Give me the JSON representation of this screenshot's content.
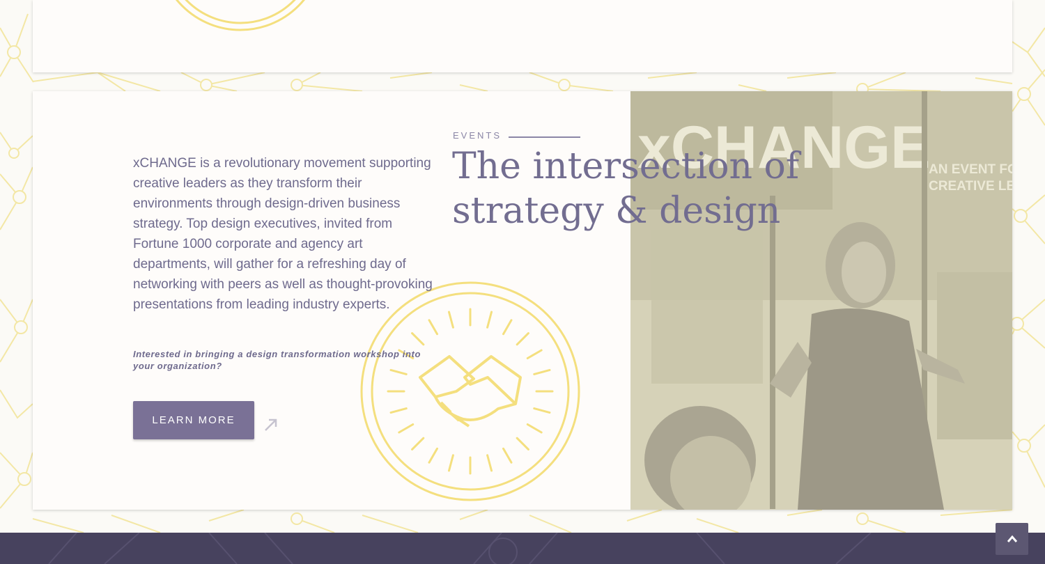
{
  "events": {
    "label": "EVENTS",
    "headline": "The intersection of strategy & design"
  },
  "intro": {
    "body": "xCHANGE is a revolutionary movement supporting creative leaders as they transform their environments through design-driven business strategy. Top design executives, invited from Fortune 1000 corporate and agency art departments, will gather for a refreshing day of networking with peers as well as thought-provoking presentations from leading industry experts.",
    "cta_note": "Interested in bringing a design transformation workshop into your organization?",
    "button_label": "LEARN MORE"
  },
  "photo": {
    "banner_primary": "xCHANGE",
    "banner_secondary": "AN EVENT FOR CREATIVE LEADERS"
  },
  "icons": {
    "handshake_emblem": "handshake-emblem-icon",
    "arrow": "arrow-up-right-icon",
    "back_to_top": "chevron-up-icon"
  },
  "colors": {
    "accent_purple": "#7a7196",
    "text_purple": "#6e6a8d",
    "emblem_yellow": "#f4df7e",
    "footer_dark": "#47425e"
  }
}
